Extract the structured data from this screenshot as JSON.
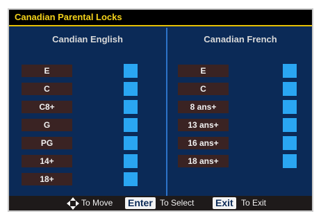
{
  "title": "Canadian Parental Locks",
  "columns": {
    "english": {
      "heading": "Candian English",
      "ratings": [
        "E",
        "C",
        "C8+",
        "G",
        "PG",
        "14+",
        "18+"
      ]
    },
    "french": {
      "heading": "Canadian French",
      "ratings": [
        "E",
        "C",
        "8 ans+",
        "13 ans+",
        "16 ans+",
        "18 ans+"
      ]
    }
  },
  "footer": {
    "move_label": "To Move",
    "enter_key": "Enter",
    "select_label": "To Select",
    "exit_key": "Exit",
    "exit_label": "To Exit"
  },
  "icons": {
    "move": "directional-arrows-icon"
  },
  "colors": {
    "background": "#0b2a57",
    "title_text": "#f4d21a",
    "title_rule": "#e6c000",
    "checkbox": "#2aa6f2",
    "rating_label_bg": "#3a2323"
  }
}
